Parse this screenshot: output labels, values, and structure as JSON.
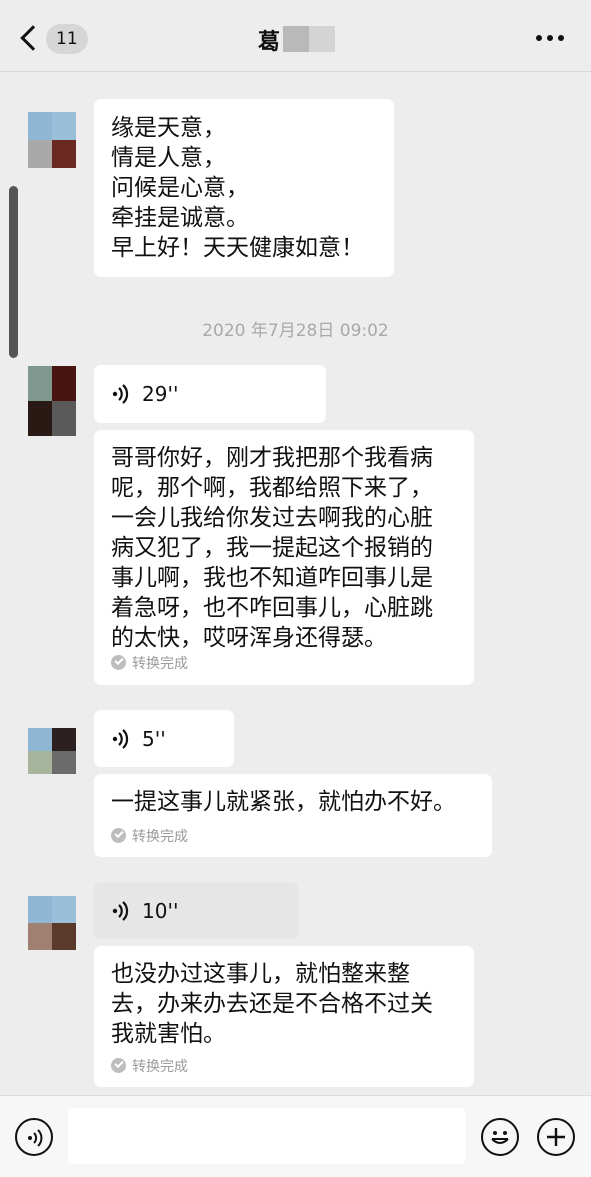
{
  "header": {
    "unread_count": "11",
    "title": "葛"
  },
  "messages": [
    {
      "type": "text",
      "text": "缘是天意，\n情是人意，\n问候是心意，\n牵挂是诚意。\n早上好！天天健康如意！"
    },
    {
      "type": "timestamp",
      "text": "2020 年7月28日 09:02"
    },
    {
      "type": "voice",
      "duration": "29''",
      "transcript": "哥哥你好，刚才我把那个我看病\n呢，那个啊，我都给照下来了，\n一会儿我给你发过去啊我的心脏\n病又犯了，我一提起这个报销的\n事儿啊，我也不知道咋回事儿是\n着急呀，也不咋回事儿，心脏跳\n的太快，哎呀浑身还得瑟。",
      "status": "转换完成"
    },
    {
      "type": "voice",
      "duration": "5''",
      "transcript": "一提这事儿就紧张，就怕办不好。",
      "status": "转换完成"
    },
    {
      "type": "voice",
      "duration": "10''",
      "transcript": "也没办过这事儿，就怕整来整\n去，办来办去还是不合格不过关\n我就害怕。",
      "status": "转换完成"
    }
  ],
  "input_bar": {
    "placeholder": "",
    "icons": [
      "voice-input-icon",
      "emoji-icon",
      "plus-icon"
    ]
  },
  "colors": {
    "background": "#ededed",
    "bubble": "#ffffff",
    "bubble_playing": "#e6e6e6",
    "muted_text": "#9b9b9b"
  }
}
